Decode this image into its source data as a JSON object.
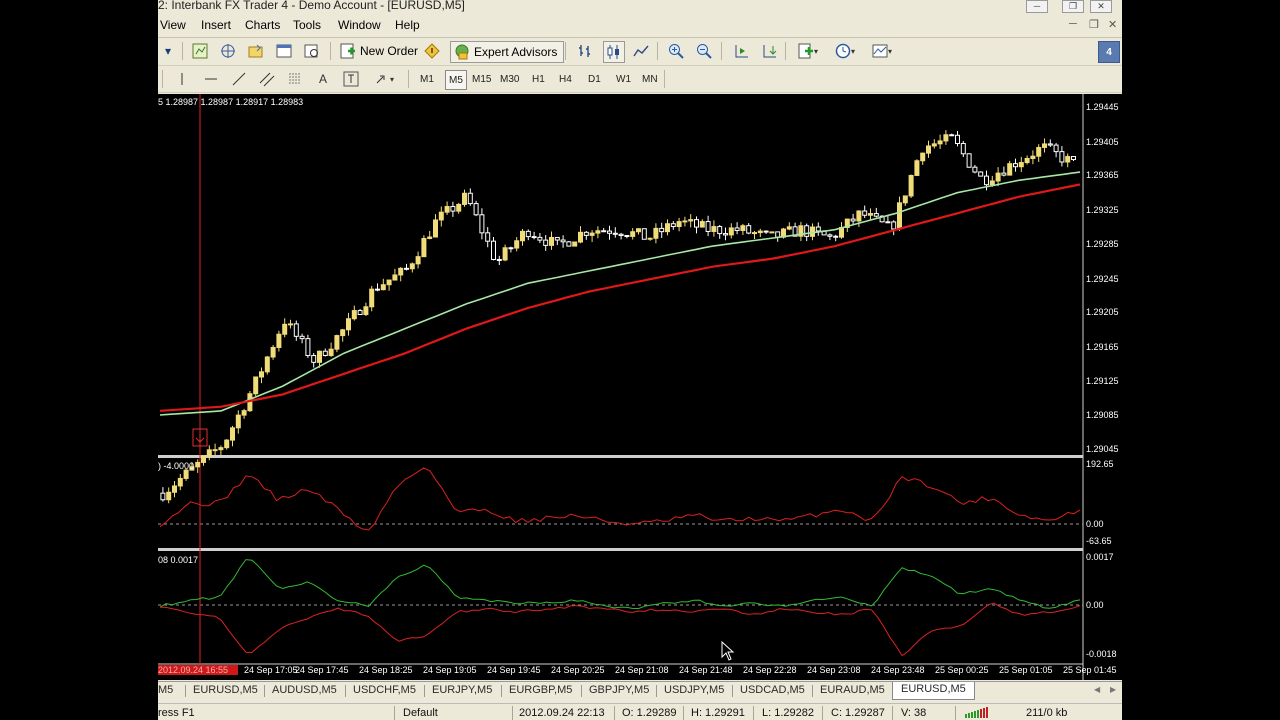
{
  "window": {
    "title": "2: Interbank FX Trader 4 - Demo Account - [EURUSD,M5]"
  },
  "window_buttons": {
    "minimize": "─",
    "restore": "❐",
    "close": "✕"
  },
  "menu": [
    "View",
    "Insert",
    "Charts",
    "Tools",
    "Window",
    "Help"
  ],
  "mdi_buttons": {
    "minimize": "─",
    "restore": "❐",
    "close": "✕"
  },
  "toolbar": {
    "new_order": "New Order",
    "expert_advisors": "Expert Advisors",
    "badge": "4",
    "timeframes": [
      "M1",
      "M5",
      "M15",
      "M30",
      "H1",
      "H4",
      "D1",
      "W1",
      "MN"
    ],
    "active_timeframe": "M5"
  },
  "chart": {
    "ohlc_header": "5  1.28987 1.28987 1.28917 1.28983",
    "indicator1_header": ") -4.0000",
    "indicator2_header": "08 0.0017",
    "price_labels": [
      "1.29445",
      "1.29405",
      "1.29365",
      "1.29325",
      "1.29285",
      "1.29245",
      "1.29205",
      "1.29165",
      "1.29125",
      "1.29085",
      "1.29045"
    ],
    "indicator1_labels": [
      "192.65",
      "0.00",
      "-63.65"
    ],
    "indicator2_labels": [
      "0.0017",
      "0.00",
      "-0.0018"
    ],
    "time_labels": [
      "2012.09.24 16:55",
      "24 Sep 17:05",
      "24 Sep 17:45",
      "24 Sep 18:25",
      "24 Sep 19:05",
      "24 Sep 19:45",
      "24 Sep 20:25",
      "24 Sep 21:08",
      "24 Sep 21:48",
      "24 Sep 22:28",
      "24 Sep 23:08",
      "24 Sep 23:48",
      "25 Sep 00:25",
      "25 Sep 01:05",
      "25 Sep 01:45"
    ],
    "colors": {
      "background": "#000000",
      "bull_candle": "#f0dc78",
      "bear_candle": "#ffffff",
      "fast_ma": "#a6e8a6",
      "slow_ma": "#e01818",
      "signal_marker": "#e03030"
    }
  },
  "chart_data": {
    "type": "candlestick",
    "symbol": "EURUSD",
    "timeframe": "M5",
    "ylim": [
      1.2903,
      1.2946
    ],
    "price_series": [
      1.2898,
      1.2901,
      1.2904,
      1.2911,
      1.2919,
      1.2914,
      1.2918,
      1.2923,
      1.2925,
      1.2931,
      1.2934,
      1.2926,
      1.293,
      1.2928,
      1.293,
      1.293,
      1.2929,
      1.2931,
      1.293,
      1.293,
      1.2929,
      1.293,
      1.2929,
      1.2932,
      1.293,
      1.294,
      1.2941,
      1.2936,
      1.2938,
      1.294,
      1.2938
    ],
    "moving_averages": [
      {
        "color": "#a6e8a6",
        "values": [
          1.29075,
          1.2908,
          1.2911,
          1.2915,
          1.2918,
          1.2921,
          1.29235,
          1.2925,
          1.29265,
          1.2928,
          1.2929,
          1.293,
          1.2932,
          1.29345,
          1.2936,
          1.2937
        ]
      },
      {
        "color": "#e01818",
        "values": [
          1.2908,
          1.29085,
          1.291,
          1.29125,
          1.2915,
          1.2918,
          1.29205,
          1.29225,
          1.2924,
          1.29255,
          1.29265,
          1.2928,
          1.293,
          1.2932,
          1.2934,
          1.29355
        ]
      }
    ],
    "indicator1": {
      "ylim": [
        -63.65,
        192.65
      ],
      "values": [
        -10,
        60,
        60,
        160,
        70,
        110,
        40,
        -40,
        120,
        190,
        30,
        40,
        0,
        10,
        20,
        0,
        -10,
        0,
        20,
        0,
        10,
        0,
        20,
        40,
        0,
        150,
        120,
        60,
        80,
        20,
        0,
        40
      ]
    },
    "indicator2": {
      "ylim": [
        -0.0018,
        0.0017
      ],
      "series": [
        {
          "color": "#33bb33",
          "values": [
            0.0,
            0.0002,
            0.0003,
            0.0017,
            0.0006,
            0.0008,
            0.0002,
            0.0,
            0.001,
            0.0014,
            0.0003,
            0.0002,
            0.0001,
            0.0001,
            0.0002,
            0.0,
            -0.0001,
            0.0001,
            0.0002,
            0.0,
            0.0001,
            0.0,
            0.0002,
            0.0003,
            0.0,
            0.0013,
            0.001,
            0.0004,
            0.0006,
            0.0002,
            -0.0001,
            0.0002
          ]
        },
        {
          "color": "#dd2222",
          "values": [
            0.0,
            -0.0002,
            -0.0004,
            -0.0017,
            -0.0008,
            -0.0004,
            -0.0001,
            -0.0003,
            -0.0012,
            -0.001,
            -0.0002,
            -0.0001,
            -0.0002,
            -0.0001,
            0.0,
            -0.0001,
            -0.0002,
            -0.0001,
            -0.0002,
            -0.0001,
            -0.0003,
            -0.0001,
            -0.0002,
            -0.0003,
            -0.0001,
            -0.0017,
            -0.0008,
            -0.0007,
            0.0001,
            -0.0003,
            -0.0002,
            0.0
          ]
        }
      ]
    }
  },
  "tabs": [
    "M5",
    "EURUSD,M5",
    "AUDUSD,M5",
    "USDCHF,M5",
    "EURJPY,M5",
    "EURGBP,M5",
    "GBPJPY,M5",
    "USDJPY,M5",
    "USDCAD,M5",
    "EURAUD,M5",
    "EURUSD,M5"
  ],
  "active_tab_index": 10,
  "status": {
    "help": "ress F1",
    "profile": "Default",
    "datetime": "2012.09.24 22:13",
    "open": "O: 1.29289",
    "high": "H: 1.29291",
    "low": "L: 1.29282",
    "close": "C: 1.29287",
    "volume": "V: 38",
    "traffic": "211/0 kb"
  }
}
